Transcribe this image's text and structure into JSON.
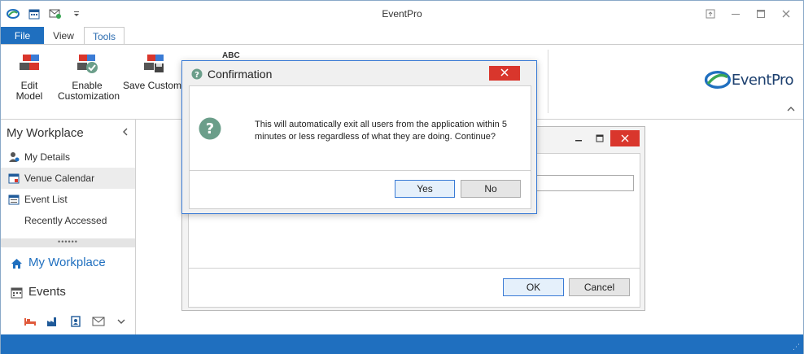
{
  "window": {
    "title": "EventPro"
  },
  "tabs": [
    {
      "label": "File"
    },
    {
      "label": "View"
    },
    {
      "label": "Tools"
    }
  ],
  "ribbon": {
    "buttons": [
      {
        "label_line1": "Edit Model",
        "label_line2": ""
      },
      {
        "label_line1": "Enable",
        "label_line2": "Customization"
      },
      {
        "label_line1": "Save Customiza",
        "label_line2": ""
      }
    ],
    "abc_label": "ABC",
    "logo": "EventPro"
  },
  "leftpanel": {
    "title": "My Workplace",
    "items": [
      {
        "label": "My Details"
      },
      {
        "label": "Venue Calendar"
      },
      {
        "label": "Event List"
      },
      {
        "label": "Recently Accessed"
      }
    ],
    "splitter": "••••••",
    "nav": [
      {
        "label": "My Workplace"
      },
      {
        "label": "Events"
      }
    ]
  },
  "bgdialog": {
    "ok_label": "OK",
    "cancel_label": "Cancel"
  },
  "modal": {
    "title": "Confirmation",
    "message": "This will automatically exit all users from the application within 5 minutes or less regardless of what they are doing. Continue?",
    "yes_label": "Yes",
    "no_label": "No"
  },
  "colors": {
    "accent": "#1f6fbf",
    "close_red": "#d9362c",
    "question_green": "#6b9e8a"
  }
}
